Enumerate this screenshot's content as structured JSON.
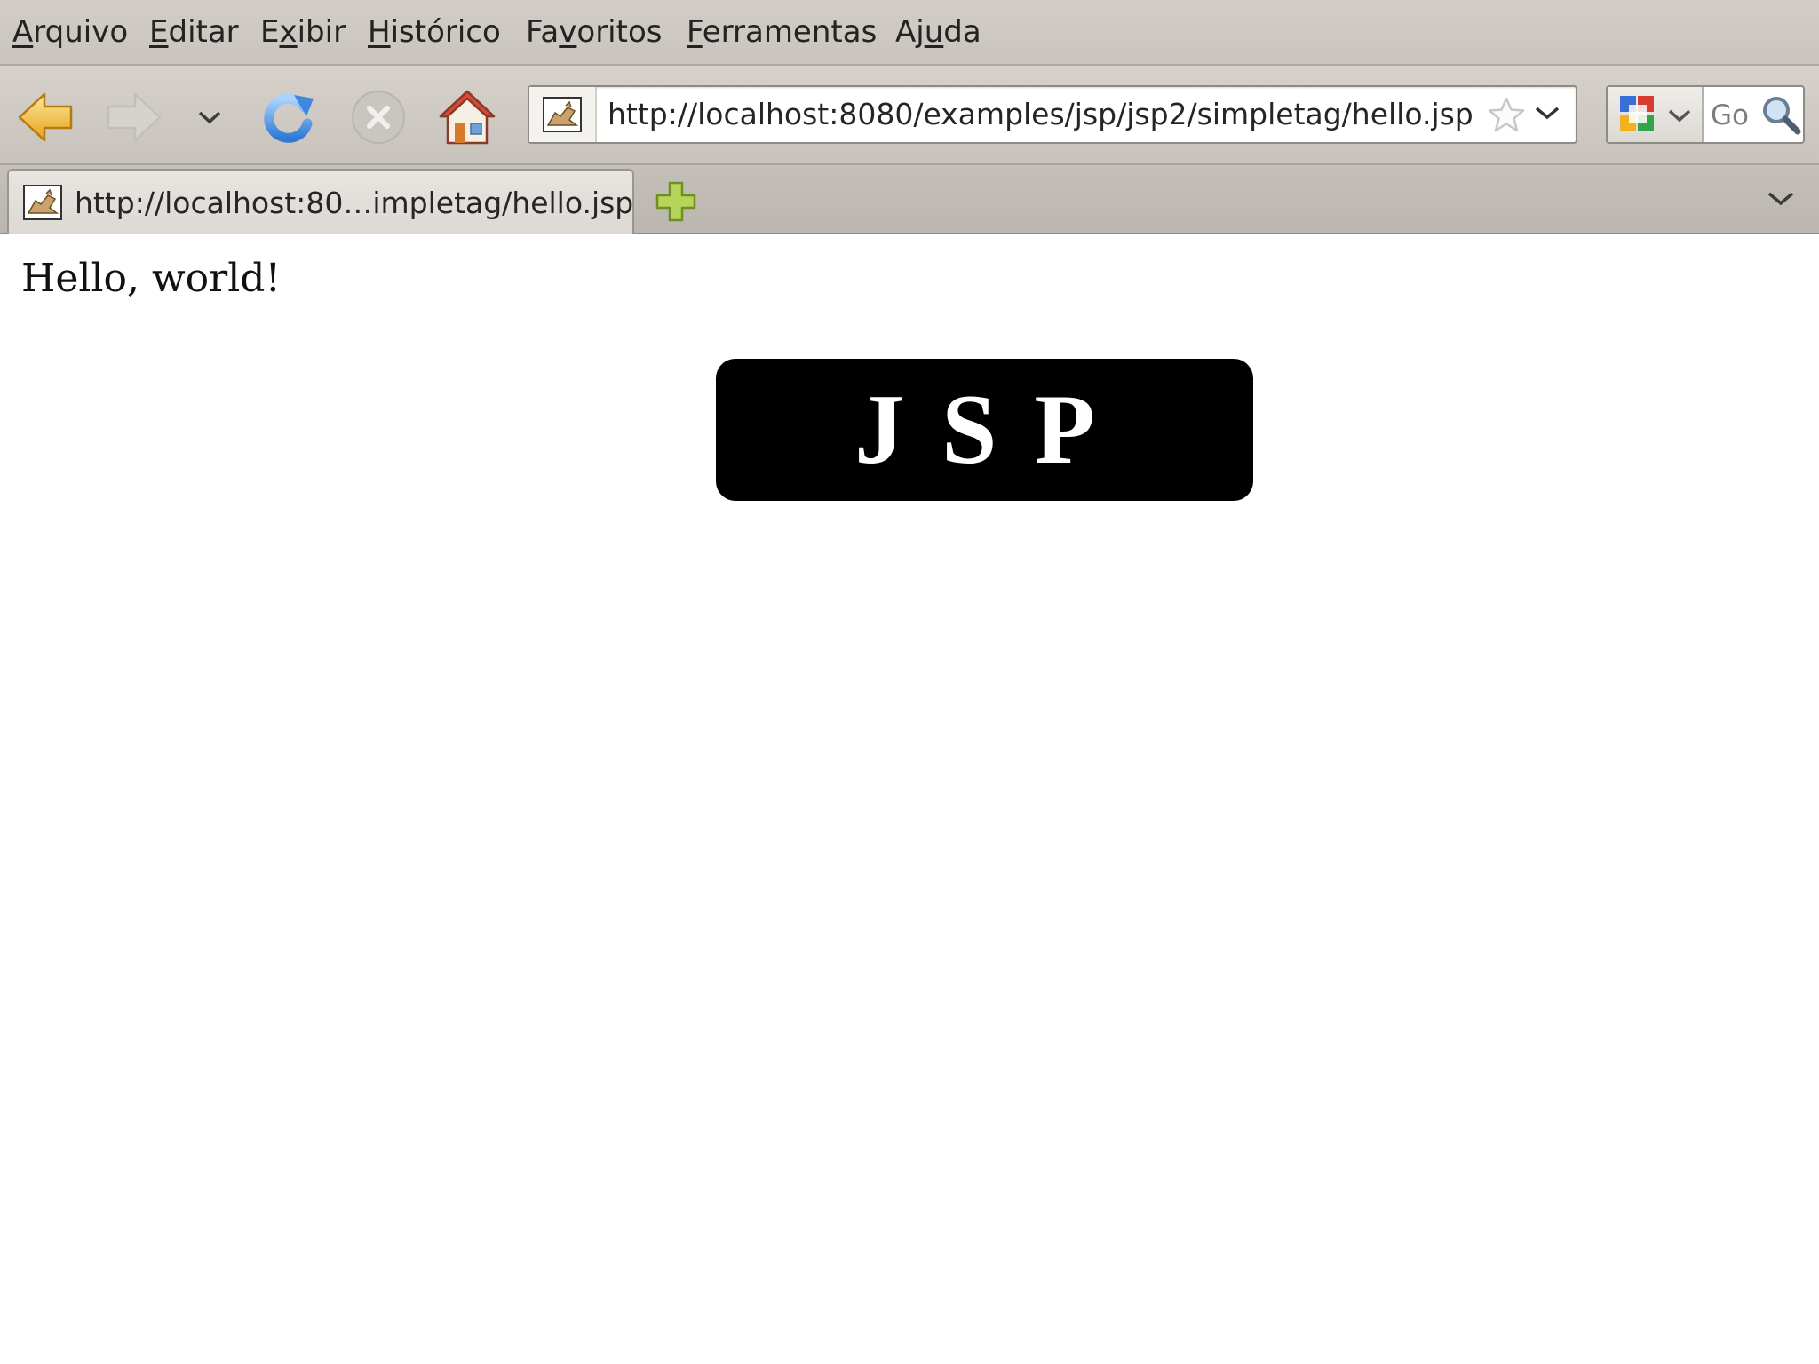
{
  "menubar": {
    "items": [
      {
        "pre": "",
        "key": "A",
        "post": "rquivo"
      },
      {
        "pre": "",
        "key": "E",
        "post": "ditar"
      },
      {
        "pre": "E",
        "key": "x",
        "post": "ibir"
      },
      {
        "pre": "",
        "key": "H",
        "post": "istórico"
      },
      {
        "pre": "Fa",
        "key": "v",
        "post": "oritos"
      },
      {
        "pre": "",
        "key": "F",
        "post": "erramentas"
      },
      {
        "pre": "Aj",
        "key": "u",
        "post": "da"
      }
    ]
  },
  "navbar": {
    "url": "http://localhost:8080/examples/jsp/jsp2/simpletag/hello.jsp",
    "search_placeholder": "Go"
  },
  "tabs": [
    {
      "title": "http://localhost:80…impletag/hello.jsp"
    }
  ],
  "content": {
    "greeting": "Hello, world!",
    "banner": "JSP"
  },
  "colors": {
    "chrome": "#c9c4bd",
    "banner_bg": "#000000",
    "banner_text": "#ffffff"
  }
}
